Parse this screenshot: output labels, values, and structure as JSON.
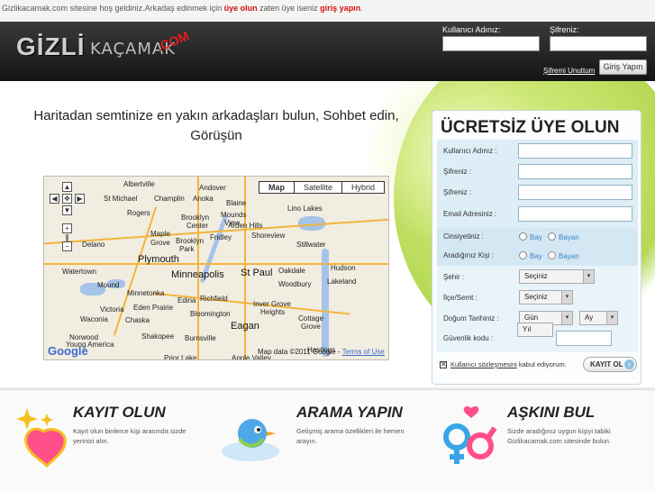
{
  "topbar": {
    "site": "Gizlikacamak.com",
    "text1": " sitesine hoş geldiniz.Arkadaş edinmek için ",
    "link1": "üye olun",
    "text2": " zaten üye iseniz ",
    "link2": "giriş yapın",
    "text3": "."
  },
  "header": {
    "logo_gizli": "GİZLİ",
    "logo_kacamak": "KAÇAMAK",
    "logo_com": ".COM",
    "username_label": "Kullanıcı Adınız:",
    "password_label": "Şifreniz:",
    "forgot_label": "Şifremi Unuttum",
    "login_button": "Giriş Yapın"
  },
  "main": {
    "headline": "Haritadan semtinize en yakın arkadaşları bulun, Sohbet edin, Görüşün"
  },
  "map": {
    "types": [
      "Map",
      "Satellite",
      "Hybrid"
    ],
    "google": "Google",
    "data_text": "Map data ©2011 Google - ",
    "terms": "Terms of Use",
    "labels": [
      {
        "t": "Albertville",
        "k": "town",
        "s": "l:88;t:4"
      },
      {
        "t": "Andover",
        "k": "town",
        "s": "l:172;t:8"
      },
      {
        "t": "St Michael",
        "k": "town",
        "s": "l:66;t:20"
      },
      {
        "t": "Champlin",
        "k": "town",
        "s": "l:122;t:20"
      },
      {
        "t": "Anoka",
        "k": "town",
        "s": "l:165;t:20"
      },
      {
        "t": "Blaine",
        "k": "town",
        "s": "l:202;t:25"
      },
      {
        "t": "Lino Lakes",
        "k": "town",
        "s": "l:270;t:31"
      },
      {
        "t": "Rogers",
        "k": "town",
        "s": "l:92;t:36"
      },
      {
        "t": "Brooklyn",
        "k": "town",
        "s": "l:152;t:41"
      },
      {
        "t": "Center",
        "k": "town",
        "s": "l:158;t:50"
      },
      {
        "t": "Mounds",
        "k": "town",
        "s": "l:196;t:38"
      },
      {
        "t": "View",
        "k": "town",
        "s": "l:200;t:47"
      },
      {
        "t": "Maple",
        "k": "town",
        "s": "l:118;t:59"
      },
      {
        "t": "Grove",
        "k": "town",
        "s": "l:118;t:69"
      },
      {
        "t": "Brooklyn",
        "k": "town",
        "s": "l:146;t:67"
      },
      {
        "t": "Park",
        "k": "town",
        "s": "l:150;t:76"
      },
      {
        "t": "Fridley",
        "k": "town",
        "s": "l:184;t:63"
      },
      {
        "t": "Arden Hills",
        "k": "town",
        "s": "l:204;t:50"
      },
      {
        "t": "Shoreview",
        "k": "town",
        "s": "l:230;t:61"
      },
      {
        "t": "Stillwater",
        "k": "town",
        "s": "l:280;t:71"
      },
      {
        "t": "Delano",
        "k": "town",
        "s": "l:42;t:71"
      },
      {
        "t": "Plymouth",
        "k": "city",
        "s": "l:104;t:86"
      },
      {
        "t": "Watertown",
        "k": "town",
        "s": "l:20;t:101"
      },
      {
        "t": "Minneapolis",
        "k": "city",
        "s": "l:141;t:103"
      },
      {
        "t": "St Paul",
        "k": "city",
        "s": "l:218;t:101"
      },
      {
        "t": "Oakdale",
        "k": "town",
        "s": "l:260;t:100"
      },
      {
        "t": "Hudson",
        "k": "town",
        "s": "l:318;t:97"
      },
      {
        "t": "Mound",
        "k": "town",
        "s": "l:59;t:116"
      },
      {
        "t": "Minnetonka",
        "k": "town",
        "s": "l:92;t:125"
      },
      {
        "t": "Woodbury",
        "k": "town",
        "s": "l:260;t:115"
      },
      {
        "t": "Lakeland",
        "k": "town",
        "s": "l:314;t:112"
      },
      {
        "t": "Edina",
        "k": "town",
        "s": "l:148;t:133"
      },
      {
        "t": "Richfield",
        "k": "town",
        "s": "l:173;t:131"
      },
      {
        "t": "Victoria",
        "k": "town",
        "s": "l:62;t:143"
      },
      {
        "t": "Eden Prairie",
        "k": "town",
        "s": "l:99;t:141"
      },
      {
        "t": "Inver Grove",
        "k": "town",
        "s": "l:232;t:137"
      },
      {
        "t": "Heights",
        "k": "town",
        "s": "l:240;t:146"
      },
      {
        "t": "Bloomington",
        "k": "town",
        "s": "l:162;t:148"
      },
      {
        "t": "Waconia",
        "k": "town",
        "s": "l:40;t:154"
      },
      {
        "t": "Chaska",
        "k": "town",
        "s": "l:90;t:155"
      },
      {
        "t": "Eagan",
        "k": "city",
        "s": "l:207;t:160"
      },
      {
        "t": "Cottage",
        "k": "town",
        "s": "l:282;t:153"
      },
      {
        "t": "Grove",
        "k": "town",
        "s": "l:285;t:162"
      },
      {
        "t": "Hastings",
        "k": "town",
        "s": "l:292;t:188"
      },
      {
        "t": "Shakopee",
        "k": "town",
        "s": "l:108;t:173"
      },
      {
        "t": "Burnsville",
        "k": "town",
        "s": "l:156;t:175"
      },
      {
        "t": "Norwood",
        "k": "town",
        "s": "l:28;t:174"
      },
      {
        "t": "Young America",
        "k": "town",
        "s": "l:24;t:182"
      },
      {
        "t": "Prior Lake",
        "k": "town",
        "s": "l:133;t:197"
      },
      {
        "t": "Apple Valley",
        "k": "town",
        "s": "l:208;t:197"
      }
    ]
  },
  "signup": {
    "title": "ÜCRETSİZ ÜYE OLUN",
    "username_label": "Kullanıcı Adınız :",
    "password_label": "Şifreniz :",
    "password2_label": "Şifreniz :",
    "email_label": "Email Adresiniz :",
    "gender_label": "Cinsiyetiniz :",
    "seeking_label": "Aradığınız Kişi :",
    "male": "Bay",
    "female": "Bayan",
    "city_label": "Şehir :",
    "district_label": "İlçe/Semt :",
    "select_default": "Seçiniz",
    "birth_label": "Doğum Tarihiniz :",
    "day": "Gün",
    "month": "Ay",
    "year": "Yıl",
    "security_label": "Güvenlik kodu :",
    "terms_link": "Kullanıcı sözleşmesini",
    "terms_text": " kabul ediyorum.",
    "register_button": "KAYIT OL"
  },
  "features": [
    {
      "title": "KAYIT OLUN",
      "desc": "Kayıt olun binlerce kişi arasında sizde yerinizi alın."
    },
    {
      "title": "ARAMA YAPIN",
      "desc": "Gelişmiş arama özellikleri ile hemen arayın."
    },
    {
      "title": "AŞKINI BUL",
      "desc": "Sizde aradığınız uygun kişiyi tabiki Gizlikacamak.com sitesinde bulun."
    }
  ]
}
